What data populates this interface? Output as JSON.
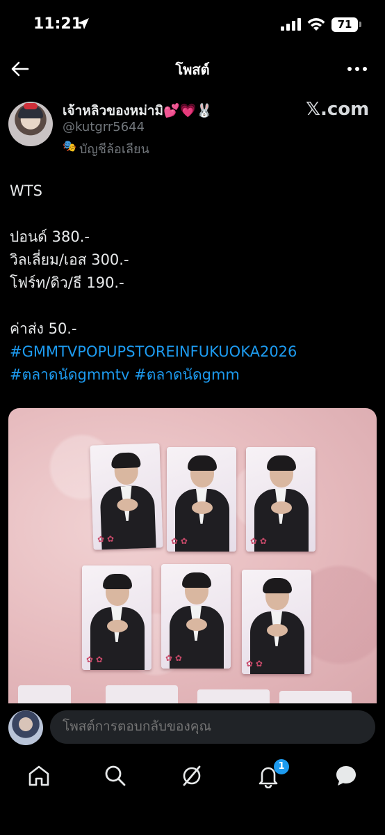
{
  "status_bar": {
    "time": "11:21",
    "battery": "71"
  },
  "nav": {
    "title": "โพสต์"
  },
  "author": {
    "name": "เจ้าหลิวของหม่ามิ💕💗🐰",
    "handle": "@kutgrr5644",
    "parody_label": "บัญชีล้อเลียน",
    "watermark": "𝕏.com"
  },
  "post": {
    "lines": [
      "WTS",
      "",
      "ปอนด์ 380.-",
      "วิลเลี่ยม/เอส 300.-",
      "โฟร์ท/ดิว/ธี 190.-",
      "",
      "ค่าส่ง 50.-"
    ],
    "hashtags": [
      "#GMMTVPOPUPSTOREINFUKUOKA2026",
      "#ตลาดนัดgmmtv",
      "#ตลาดนัดgmm"
    ]
  },
  "reply": {
    "placeholder": "โพสต์การตอบกลับของคุณ"
  },
  "tabbar": {
    "notifications_count": "1"
  },
  "colors": {
    "accent": "#1d9bf0",
    "background": "#000000",
    "text": "#e7e9ea",
    "muted": "#71767b"
  }
}
